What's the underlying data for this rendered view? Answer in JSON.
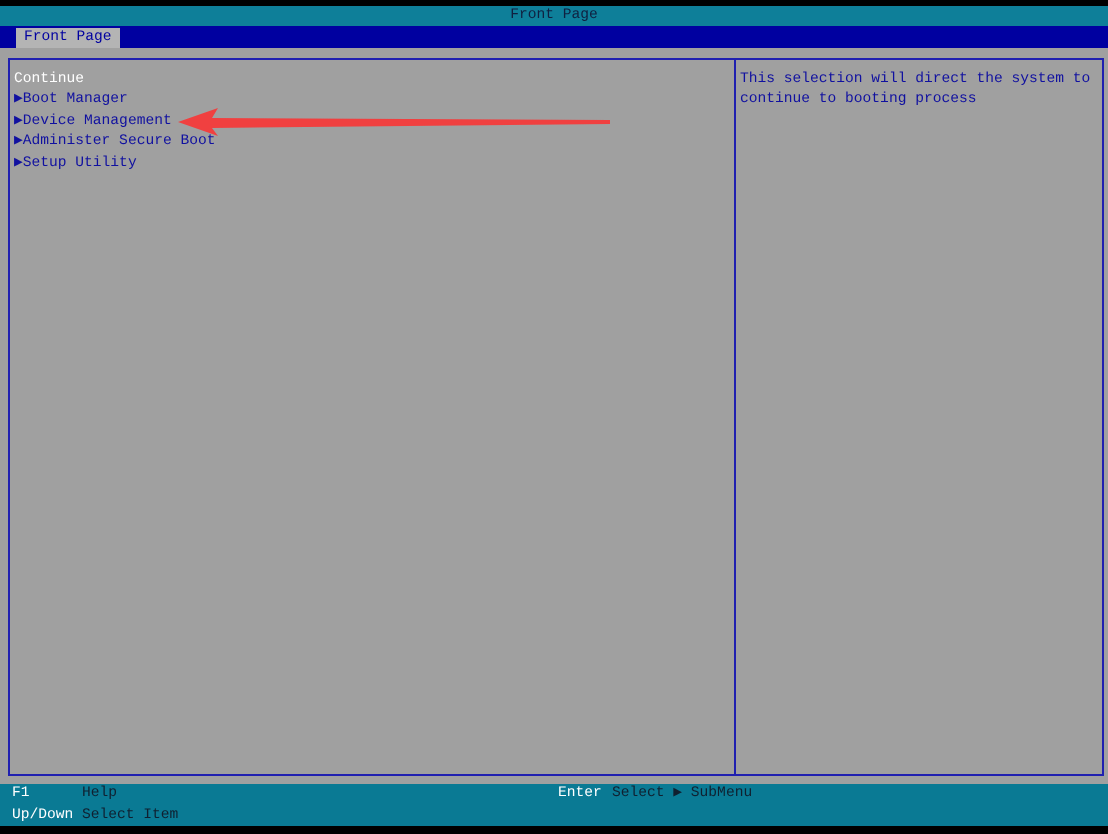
{
  "title_bar": {
    "title": "Front Page"
  },
  "tabs": [
    {
      "label": "Front Page",
      "selected": true
    }
  ],
  "menu": [
    {
      "label": "Continue",
      "selected": true
    },
    {
      "label": "Boot Manager",
      "marker": "▶",
      "selected": false
    },
    {
      "label": "Device Management",
      "marker": "▶",
      "selected": false
    },
    {
      "label": "Administer Secure Boot",
      "marker": "▶",
      "selected": false
    },
    {
      "label": "Setup Utility",
      "marker": "▶",
      "selected": false
    }
  ],
  "help_text": "This selection will direct the system to continue to booting process",
  "footer": [
    {
      "key": "F1",
      "action": "Help"
    },
    {
      "key": "Enter",
      "action": "Select ▶ SubMenu"
    },
    {
      "key": "Up/Down",
      "action": "Select Item"
    }
  ]
}
